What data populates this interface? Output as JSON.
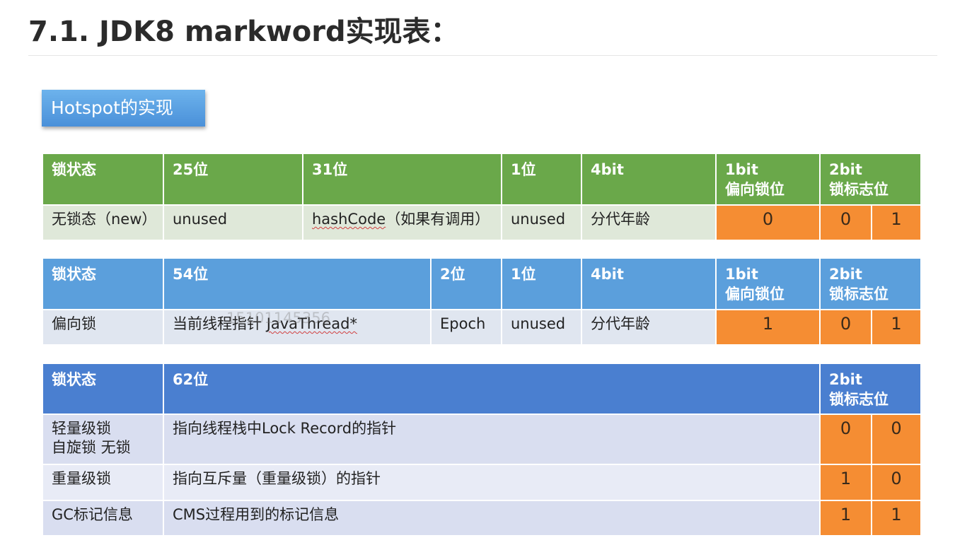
{
  "title": "7.1. JDK8 markword实现表：",
  "badge": "Hotspot的实现",
  "watermark": "15101145356",
  "table1": {
    "headers": [
      "锁状态",
      "25位",
      "31位",
      "1位",
      "4bit",
      "1bit",
      "偏向锁位",
      "2bit",
      "锁标志位"
    ],
    "row": [
      "无锁态（new）",
      "unused",
      "hashCode",
      "（如果有调用）",
      "unused",
      "分代年龄",
      "0",
      "0",
      "1"
    ]
  },
  "table2": {
    "headers": [
      "锁状态",
      "54位",
      "2位",
      "1位",
      "4bit",
      "1bit",
      "偏向锁位",
      "2bit",
      "锁标志位"
    ],
    "row": [
      "偏向锁",
      "当前线程指针 ",
      "JavaThread*",
      "Epoch",
      "unused",
      "分代年龄",
      "1",
      "0",
      "1"
    ]
  },
  "table3": {
    "headers": [
      "锁状态",
      "62位",
      "2bit",
      "锁标志位"
    ],
    "rows": [
      {
        "state_line1": "轻量级锁",
        "state_line2": "自旋锁 无锁",
        "desc": "指向线程栈中Lock Record的指针",
        "b1": "0",
        "b2": "0"
      },
      {
        "state_line1": "重量级锁",
        "state_line2": "",
        "desc": "指向互斥量（重量级锁）的指针",
        "b1": "1",
        "b2": "0"
      },
      {
        "state_line1": "GC标记信息",
        "state_line2": "",
        "desc": "CMS过程用到的标记信息",
        "b1": "1",
        "b2": "1"
      }
    ]
  }
}
